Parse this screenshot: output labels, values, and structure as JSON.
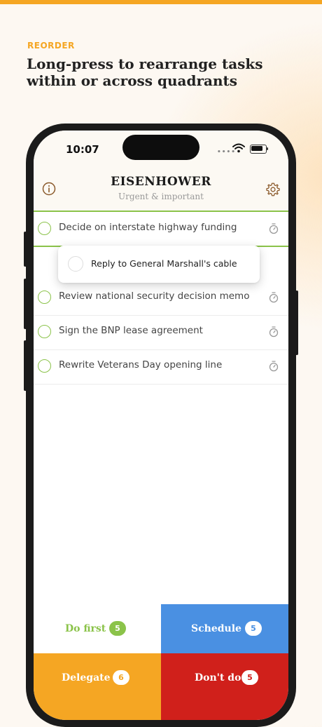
{
  "promo": {
    "eyebrow": "REORDER",
    "headline_line1": "Long-press to rearrange tasks",
    "headline_line2": "within or across quadrants"
  },
  "status_bar": {
    "time": "10:07",
    "signal": "••••"
  },
  "header": {
    "title": "EISENHOWER",
    "subtitle": "Urgent & important"
  },
  "tasks": [
    {
      "label": "Decide on interstate highway funding"
    },
    {
      "label": "Review national security decision memo"
    },
    {
      "label": "Sign the BNP lease agreement"
    },
    {
      "label": "Rewrite Veterans Day opening line"
    }
  ],
  "dragging_task": {
    "label": "Reply to General Marshall's cable"
  },
  "quadrants": [
    {
      "label": "Do first",
      "count": "5",
      "bg": "#ffffff",
      "text_color": "#8bc34a",
      "badge_bg": "#8bc34a",
      "badge_text": "#ffffff"
    },
    {
      "label": "Schedule",
      "count": "5",
      "bg": "#4a90e2",
      "text_color": "#ffffff",
      "badge_bg": "#ffffff",
      "badge_text": "#4a90e2"
    },
    {
      "label": "Delegate",
      "count": "6",
      "bg": "#f5a623",
      "text_color": "#ffffff",
      "badge_bg": "#ffffff",
      "badge_text": "#f5a623"
    },
    {
      "label": "Don't do",
      "count": "5",
      "bg": "#d0201b",
      "text_color": "#ffffff",
      "badge_bg": "#ffffff",
      "badge_text": "#d0201b"
    }
  ],
  "colors": {
    "accent": "#f5a623",
    "green": "#8bc34a",
    "header_icons": "#8b5a2b"
  },
  "icons": {
    "info": "info-icon",
    "settings": "gear-icon",
    "timer": "stopwatch-icon",
    "wifi": "wifi-icon",
    "battery": "battery-icon"
  }
}
